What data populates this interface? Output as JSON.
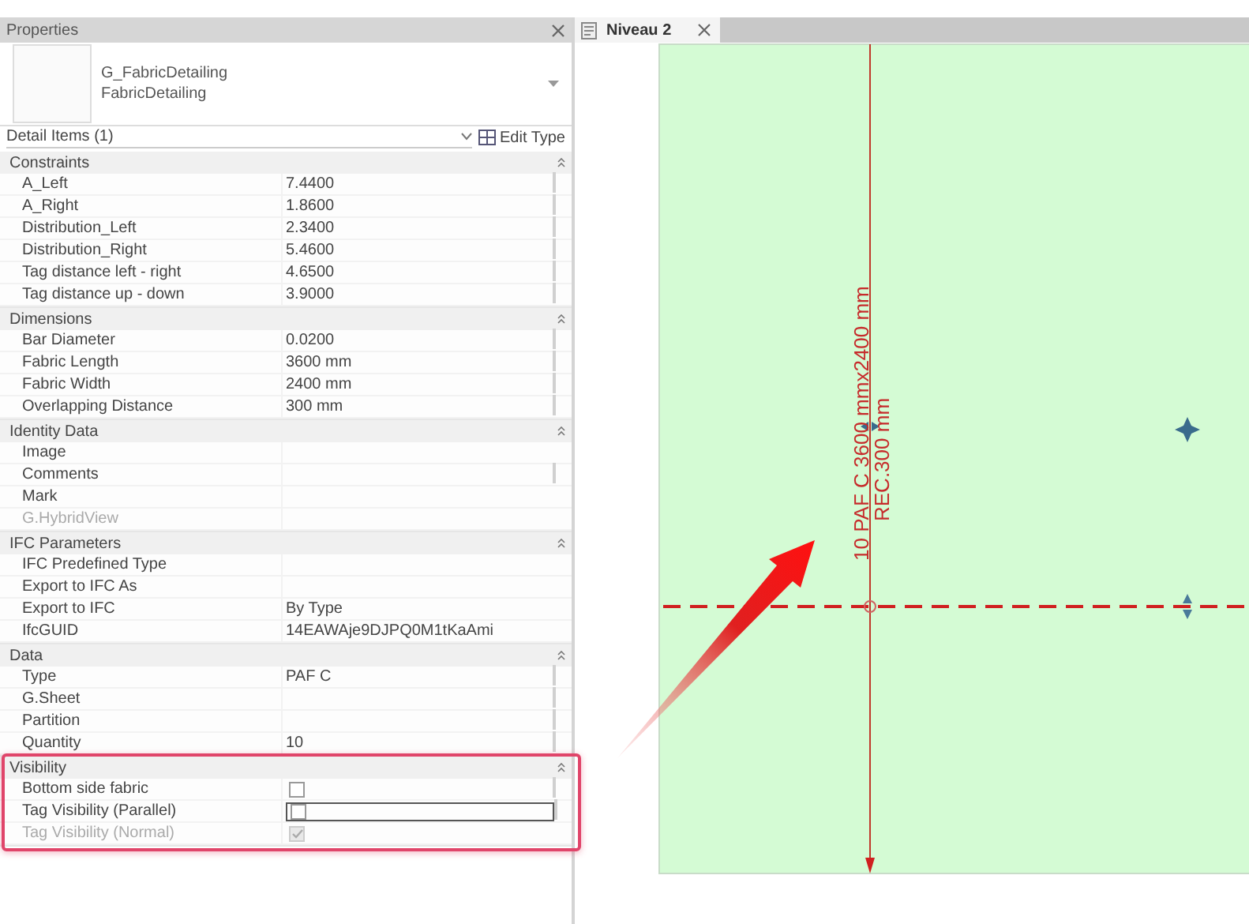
{
  "properties": {
    "title": "Properties",
    "type_selector": {
      "family": "G_FabricDetailing",
      "type": "FabricDetailing"
    },
    "filter": "Detail Items (1)",
    "edit_type": "Edit Type",
    "groups": [
      {
        "name": "Constraints",
        "highlighted": false,
        "rows": [
          {
            "kind": "text",
            "label": "A_Left",
            "value": "7.4400",
            "param_button": true,
            "disabled": false,
            "focused": false
          },
          {
            "kind": "text",
            "label": "A_Right",
            "value": "1.8600",
            "param_button": true,
            "disabled": false,
            "focused": false
          },
          {
            "kind": "text",
            "label": "Distribution_Left",
            "value": "2.3400",
            "param_button": true,
            "disabled": false,
            "focused": false
          },
          {
            "kind": "text",
            "label": "Distribution_Right",
            "value": "5.4600",
            "param_button": true,
            "disabled": false,
            "focused": false
          },
          {
            "kind": "text",
            "label": "Tag distance left - right",
            "value": "4.6500",
            "param_button": true,
            "disabled": false,
            "focused": false
          },
          {
            "kind": "text",
            "label": "Tag distance up - down",
            "value": "3.9000",
            "param_button": true,
            "disabled": false,
            "focused": false
          }
        ]
      },
      {
        "name": "Dimensions",
        "highlighted": false,
        "rows": [
          {
            "kind": "text",
            "label": "Bar Diameter",
            "value": "0.0200",
            "param_button": true,
            "disabled": false,
            "focused": false
          },
          {
            "kind": "text",
            "label": "Fabric Length",
            "value": "3600 mm",
            "param_button": true,
            "disabled": false,
            "focused": false
          },
          {
            "kind": "text",
            "label": "Fabric Width",
            "value": "2400 mm",
            "param_button": true,
            "disabled": false,
            "focused": false
          },
          {
            "kind": "text",
            "label": "Overlapping Distance",
            "value": "300 mm",
            "param_button": true,
            "disabled": false,
            "focused": false
          }
        ]
      },
      {
        "name": "Identity Data",
        "highlighted": false,
        "rows": [
          {
            "kind": "text",
            "label": "Image",
            "param_button": false,
            "disabled": false,
            "focused": false
          },
          {
            "kind": "text",
            "label": "Comments",
            "param_button": true,
            "disabled": false,
            "focused": false
          },
          {
            "kind": "text",
            "label": "Mark",
            "param_button": false,
            "disabled": false,
            "focused": false
          },
          {
            "kind": "text",
            "label": "G.HybridView",
            "param_button": false,
            "disabled": true,
            "focused": false
          }
        ]
      },
      {
        "name": "IFC Parameters",
        "highlighted": false,
        "rows": [
          {
            "kind": "text",
            "label": "IFC Predefined Type",
            "param_button": false,
            "disabled": false,
            "focused": false
          },
          {
            "kind": "text",
            "label": "Export to IFC As",
            "param_button": false,
            "disabled": false,
            "focused": false
          },
          {
            "kind": "text",
            "label": "Export to IFC",
            "value": "By Type",
            "param_button": false,
            "disabled": false,
            "focused": false
          },
          {
            "kind": "text",
            "label": "IfcGUID",
            "value": "14EAWAje9DJPQ0M1tKaAmi",
            "param_button": false,
            "disabled": false,
            "focused": false
          }
        ]
      },
      {
        "name": "Data",
        "highlighted": false,
        "rows": [
          {
            "kind": "text",
            "label": "Type",
            "value": "PAF C",
            "param_button": true,
            "disabled": false,
            "focused": false
          },
          {
            "kind": "text",
            "label": "G.Sheet",
            "param_button": true,
            "disabled": false,
            "focused": false
          },
          {
            "kind": "text",
            "label": "Partition",
            "param_button": true,
            "disabled": false,
            "focused": false
          },
          {
            "kind": "text",
            "label": "Quantity",
            "value": "10",
            "param_button": true,
            "disabled": false,
            "focused": false
          }
        ]
      },
      {
        "name": "Visibility",
        "highlighted": true,
        "rows": [
          {
            "kind": "checkbox",
            "label": "Bottom side fabric",
            "checked": false,
            "param_button": true,
            "disabled": false,
            "focused": false
          },
          {
            "kind": "checkbox",
            "label": "Tag Visibility (Parallel)",
            "checked": false,
            "param_button": true,
            "disabled": false,
            "focused": true
          },
          {
            "kind": "checkbox",
            "label": "Tag Visibility (Normal)",
            "checked": true,
            "param_button": false,
            "disabled": true,
            "focused": false
          }
        ]
      }
    ]
  },
  "view": {
    "tab": {
      "title": "Niveau 2",
      "selected": true
    },
    "tags": [
      "10 PAF C 3600 mmx2400 mm",
      "REC.300 mm"
    ]
  }
}
